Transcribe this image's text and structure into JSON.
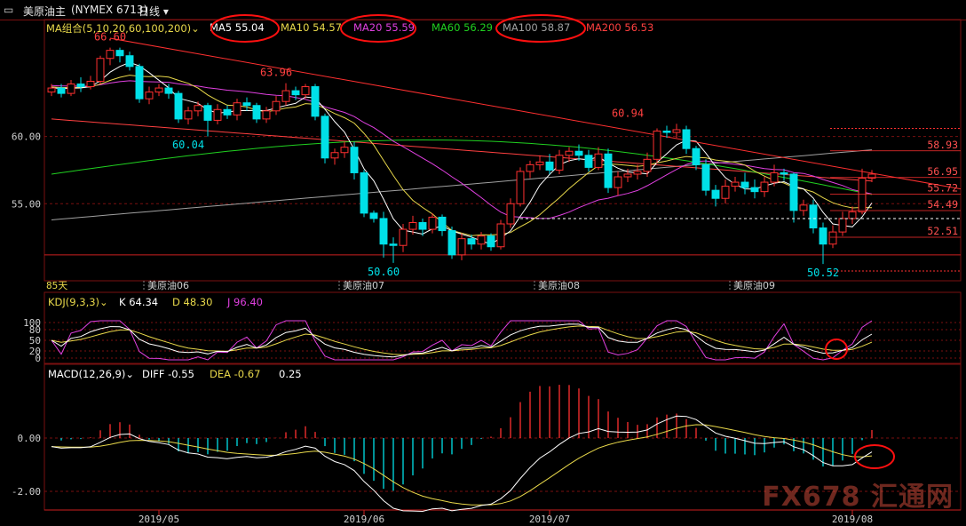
{
  "window": {
    "menu_icon": "window-menu-icon",
    "title": "美原油主",
    "code": "(NYMEX 6713)",
    "period": "日线"
  },
  "ma_header": {
    "label": "MA组合(5,10,20,60,100,200)",
    "items": [
      {
        "name": "MA5",
        "text": "MA5 55.04",
        "color": "#ffffff"
      },
      {
        "name": "MA10",
        "text": "MA10 54.57",
        "color": "#e8d84a"
      },
      {
        "name": "MA20",
        "text": "MA20 55.59",
        "color": "#e040e0"
      },
      {
        "name": "MA60",
        "text": "MA60 56.29",
        "color": "#20d020"
      },
      {
        "name": "MA100",
        "text": "MA100 58.87",
        "color": "#a0a0a0"
      },
      {
        "name": "MA200",
        "text": "MA200 56.53",
        "color": "#ff4040"
      }
    ]
  },
  "kdj_header": {
    "label": "KDJ(9,3,3)",
    "items": [
      {
        "text": "K 64.34",
        "color": "#ffffff"
      },
      {
        "text": "D 48.30",
        "color": "#e8d84a"
      },
      {
        "text": "J 96.40",
        "color": "#e040e0"
      }
    ]
  },
  "macd_header": {
    "label": "MACD(12,26,9)",
    "items": [
      {
        "text": "DIFF -0.55",
        "color": "#ffffff"
      },
      {
        "text": "DEA -0.67",
        "color": "#e8d84a"
      },
      {
        "text": "0.25",
        "color": "#ffffff"
      }
    ]
  },
  "watermark": "FX678 汇通网",
  "colors": {
    "up": "#ff3030",
    "down": "#00e0e8",
    "grid": "#7a1010",
    "axis": "#cc2020"
  },
  "chart_data": {
    "type": "candlestick",
    "price_axis_ticks": [
      60.0,
      55.0
    ],
    "price_range": [
      50.0,
      67.5
    ],
    "days_label": "85天",
    "contract_labels": [
      {
        "text": "美原油06",
        "at": 10
      },
      {
        "text": "美原油07",
        "at": 30
      },
      {
        "text": "美原油08",
        "at": 50
      },
      {
        "text": "美原油09",
        "at": 70
      }
    ],
    "date_labels": [
      {
        "text": "2019/05",
        "at": 11
      },
      {
        "text": "2019/06",
        "at": 32
      },
      {
        "text": "2019/07",
        "at": 51
      },
      {
        "text": "2019/08",
        "at": 82
      }
    ],
    "annotations": [
      {
        "text": "66.60",
        "i": 6,
        "price": 66.6,
        "pos": "above",
        "color": "#ff4040"
      },
      {
        "text": "60.04",
        "i": 14,
        "price": 60.04,
        "pos": "below",
        "color": "#00e0e8"
      },
      {
        "text": "63.96",
        "i": 23,
        "price": 63.96,
        "pos": "above",
        "color": "#ff4040"
      },
      {
        "text": "50.60",
        "i": 34,
        "price": 50.6,
        "pos": "below",
        "color": "#00e0e8"
      },
      {
        "text": "60.94",
        "i": 59,
        "price": 60.94,
        "pos": "above",
        "color": "#ff4040"
      },
      {
        "text": "50.52",
        "i": 79,
        "price": 50.52,
        "pos": "below",
        "color": "#00e0e8"
      }
    ],
    "right_levels": [
      {
        "text": "58.93",
        "price": 58.93,
        "style": "solid"
      },
      {
        "text": "56.95",
        "price": 56.95,
        "style": "solid"
      },
      {
        "text": "55.72",
        "price": 55.72,
        "style": "solid"
      },
      {
        "text": "54.49",
        "price": 54.49,
        "style": "solid"
      },
      {
        "text": "52.51",
        "price": 52.51,
        "style": "solid"
      }
    ],
    "candles": [
      [
        63.3,
        63.6,
        63.9,
        63.0
      ],
      [
        63.6,
        63.2,
        63.9,
        62.9
      ],
      [
        63.2,
        63.9,
        64.2,
        63.0
      ],
      [
        63.9,
        63.7,
        64.4,
        63.3
      ],
      [
        63.7,
        64.1,
        64.5,
        63.5
      ],
      [
        64.1,
        65.8,
        66.0,
        63.9
      ],
      [
        65.8,
        66.4,
        66.6,
        65.3
      ],
      [
        66.4,
        66.0,
        66.6,
        65.5
      ],
      [
        66.0,
        65.2,
        66.3,
        64.9
      ],
      [
        65.2,
        62.8,
        65.4,
        62.5
      ],
      [
        62.8,
        63.3,
        63.7,
        62.4
      ],
      [
        63.3,
        63.6,
        63.9,
        63.0
      ],
      [
        63.6,
        63.2,
        63.9,
        62.8
      ],
      [
        63.2,
        61.3,
        63.4,
        61.0
      ],
      [
        61.3,
        61.9,
        62.2,
        60.9
      ],
      [
        61.9,
        62.3,
        62.6,
        61.5
      ],
      [
        62.3,
        61.2,
        62.5,
        60.0
      ],
      [
        61.2,
        62.0,
        62.4,
        60.9
      ],
      [
        62.0,
        61.6,
        62.3,
        61.3
      ],
      [
        61.6,
        62.5,
        62.8,
        61.2
      ],
      [
        62.5,
        62.3,
        62.9,
        61.9
      ],
      [
        62.3,
        61.3,
        62.5,
        61.0
      ],
      [
        61.3,
        61.9,
        62.2,
        61.0
      ],
      [
        61.9,
        62.6,
        63.0,
        61.6
      ],
      [
        62.6,
        63.4,
        63.96,
        62.3
      ],
      [
        63.4,
        63.1,
        63.7,
        62.7
      ],
      [
        63.1,
        63.7,
        63.9,
        62.8
      ],
      [
        63.7,
        61.5,
        63.9,
        61.2
      ],
      [
        61.5,
        58.4,
        61.7,
        58.0
      ],
      [
        58.4,
        58.8,
        59.1,
        57.9
      ],
      [
        58.8,
        59.2,
        59.6,
        58.4
      ],
      [
        59.2,
        57.3,
        59.6,
        56.8
      ],
      [
        57.3,
        54.3,
        57.5,
        54.0
      ],
      [
        54.3,
        53.9,
        54.5,
        53.6
      ],
      [
        53.9,
        52.0,
        54.4,
        51.0
      ],
      [
        52.0,
        51.9,
        52.5,
        50.6
      ],
      [
        51.9,
        53.1,
        53.5,
        51.4
      ],
      [
        53.1,
        53.6,
        54.1,
        52.7
      ],
      [
        53.6,
        53.1,
        53.9,
        52.6
      ],
      [
        53.1,
        54.0,
        54.3,
        52.8
      ],
      [
        54.0,
        53.0,
        54.2,
        52.6
      ],
      [
        53.0,
        51.2,
        53.3,
        50.9
      ],
      [
        51.2,
        52.4,
        52.8,
        50.8
      ],
      [
        52.4,
        52.0,
        52.7,
        51.6
      ],
      [
        52.0,
        52.6,
        52.9,
        51.6
      ],
      [
        52.6,
        51.8,
        52.8,
        51.5
      ],
      [
        51.8,
        53.5,
        53.8,
        51.6
      ],
      [
        53.5,
        55.0,
        55.4,
        53.2
      ],
      [
        55.0,
        57.4,
        57.7,
        54.8
      ],
      [
        57.4,
        57.9,
        58.2,
        56.9
      ],
      [
        57.9,
        58.1,
        58.6,
        57.5
      ],
      [
        58.1,
        57.5,
        58.7,
        57.2
      ],
      [
        57.5,
        58.6,
        59.0,
        57.2
      ],
      [
        58.6,
        58.9,
        59.2,
        58.1
      ],
      [
        58.9,
        58.6,
        59.4,
        58.2
      ],
      [
        58.6,
        57.7,
        59.0,
        57.4
      ],
      [
        57.7,
        58.7,
        59.2,
        57.5
      ],
      [
        58.7,
        56.2,
        59.1,
        55.8
      ],
      [
        56.2,
        57.0,
        57.4,
        55.6
      ],
      [
        57.0,
        57.2,
        57.6,
        56.6
      ],
      [
        57.2,
        57.4,
        57.9,
        56.8
      ],
      [
        57.4,
        58.3,
        58.8,
        57.0
      ],
      [
        58.3,
        60.4,
        60.6,
        58.0
      ],
      [
        60.4,
        60.3,
        60.8,
        59.9
      ],
      [
        60.3,
        60.5,
        60.94,
        59.9
      ],
      [
        60.5,
        59.1,
        60.8,
        58.7
      ],
      [
        59.1,
        57.9,
        59.3,
        57.5
      ],
      [
        57.9,
        56.0,
        58.3,
        55.6
      ],
      [
        56.0,
        55.4,
        56.4,
        54.8
      ],
      [
        55.4,
        56.3,
        56.8,
        55.0
      ],
      [
        56.3,
        56.6,
        57.0,
        55.9
      ],
      [
        56.6,
        56.2,
        57.3,
        55.7
      ],
      [
        56.2,
        55.9,
        56.8,
        55.4
      ],
      [
        55.9,
        56.6,
        57.0,
        55.5
      ],
      [
        56.6,
        57.3,
        57.9,
        56.3
      ],
      [
        57.3,
        57.2,
        57.6,
        56.7
      ],
      [
        57.2,
        54.5,
        57.3,
        53.6
      ],
      [
        54.5,
        54.9,
        55.3,
        54.1
      ],
      [
        54.9,
        53.2,
        55.3,
        52.8
      ],
      [
        53.2,
        52.0,
        53.6,
        50.52
      ],
      [
        52.0,
        52.9,
        53.4,
        51.7
      ],
      [
        52.9,
        53.9,
        54.4,
        52.6
      ],
      [
        53.9,
        54.4,
        54.8,
        53.5
      ],
      [
        54.4,
        56.9,
        57.6,
        54.2
      ],
      [
        56.9,
        57.2,
        57.5,
        56.6
      ]
    ]
  }
}
